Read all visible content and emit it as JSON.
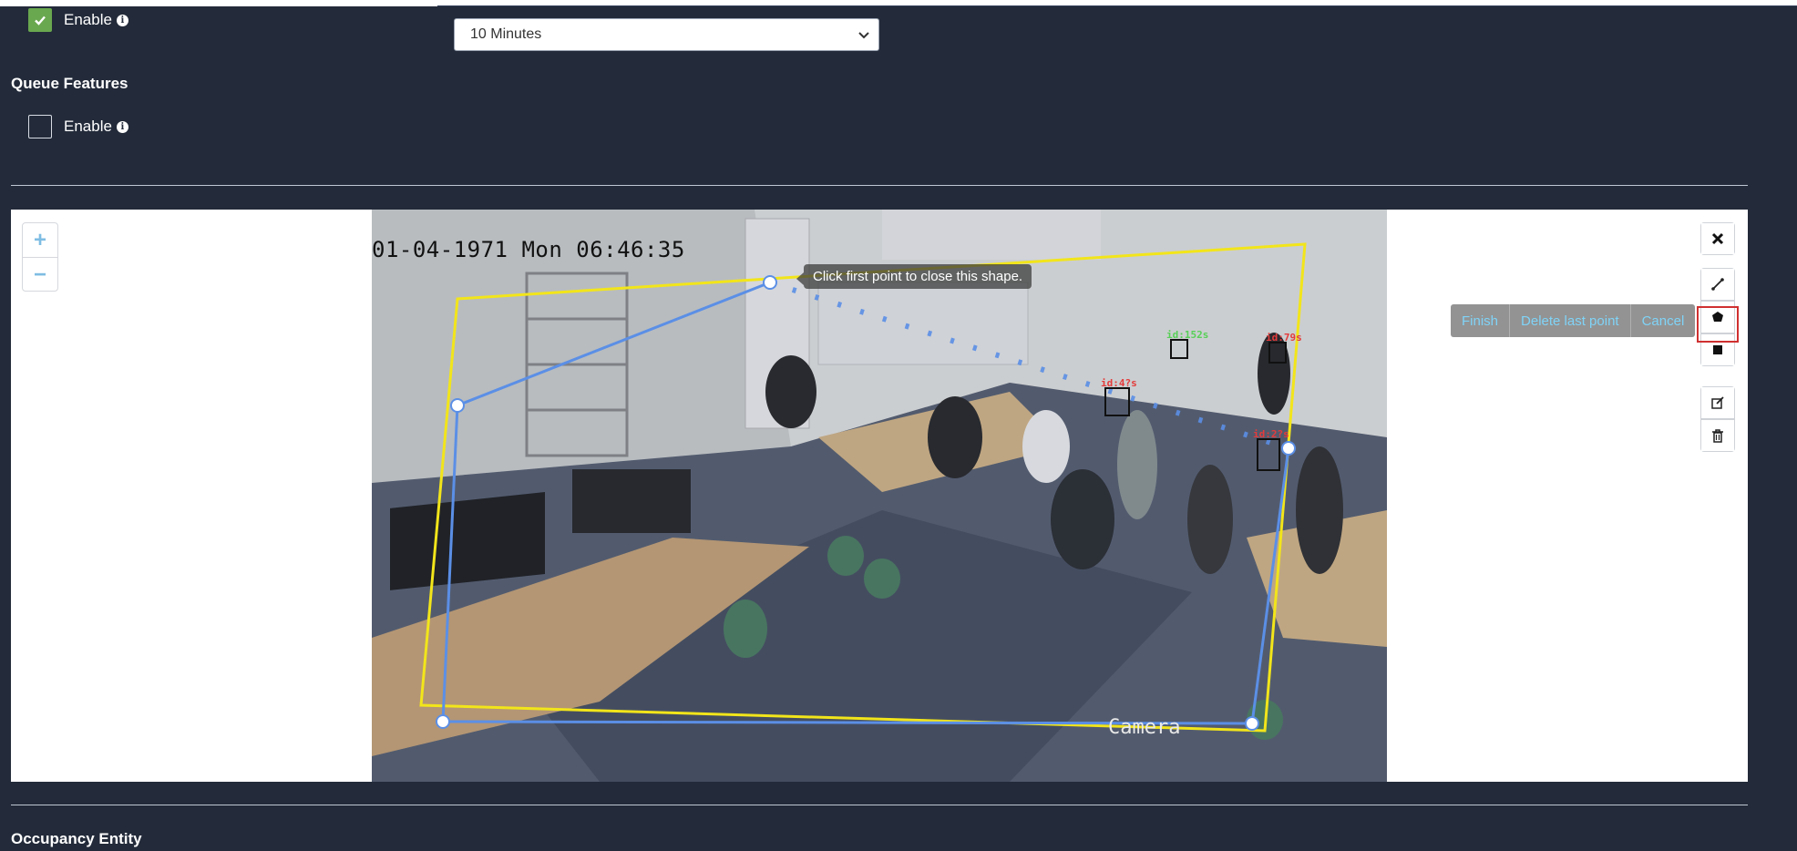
{
  "alerts_section": {
    "enable_label": "Enable",
    "enable_checked": true,
    "interval_select_value": "10 Minutes"
  },
  "queue_features": {
    "title": "Queue Features",
    "enable_label": "Enable",
    "enable_checked": false
  },
  "map": {
    "zoom_in": "+",
    "zoom_out": "−",
    "camera_timestamp": "01-04-1971 Mon 06:46:35",
    "camera_label": "Camera",
    "tooltip": "Click first point to close this shape.",
    "detections": [
      "id:152s",
      "id:79s",
      "id:4?s",
      "id:2?s"
    ],
    "draw_actions": {
      "finish": "Finish",
      "delete_last": "Delete last point",
      "cancel": "Cancel"
    },
    "toolbar_icons": [
      "close-icon",
      "polyline-icon",
      "polygon-icon",
      "rectangle-icon",
      "edit-icon",
      "trash-icon"
    ],
    "colors": {
      "yellow_zone": "#f2e51a",
      "blue_zone": "#5b8fe6",
      "highlight": "#d03030"
    }
  },
  "occupancy": {
    "title": "Occupancy Entity"
  }
}
